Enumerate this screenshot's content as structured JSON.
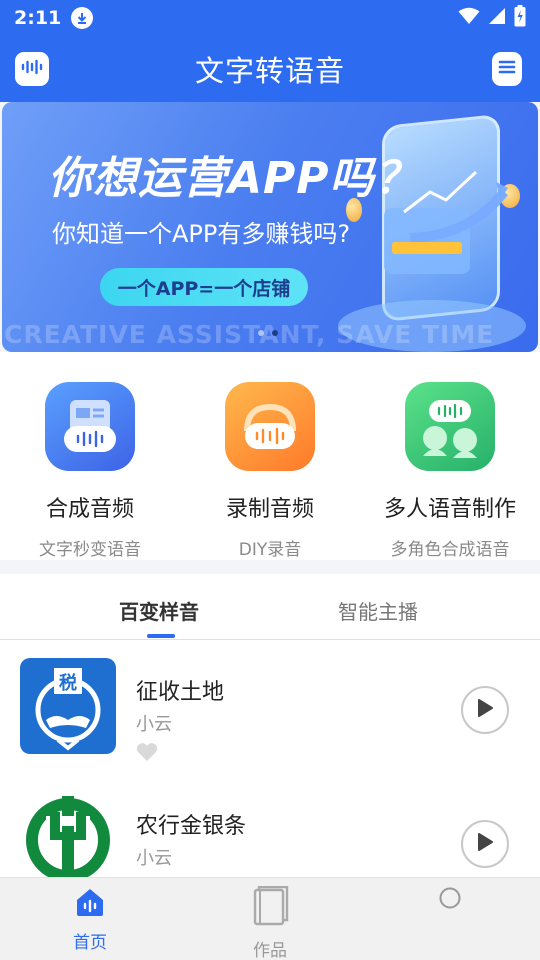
{
  "status_bar": {
    "time": "2:11"
  },
  "header": {
    "title": "文字转语音"
  },
  "banner": {
    "headline": "你想运营APP吗？",
    "subline": "你知道一个APP有多赚钱吗?",
    "pill_label": "一个APP=一个店铺",
    "watermark": "CREATIVE ASSISTANT, SAVE TIME"
  },
  "quick_actions": [
    {
      "title": "合成音频",
      "subtitle": "文字秒变语音"
    },
    {
      "title": "录制音频",
      "subtitle": "DIY录音"
    },
    {
      "title": "多人语音制作",
      "subtitle": "多角色合成语音"
    }
  ],
  "tabs": [
    {
      "label": "百变样音"
    },
    {
      "label": "智能主播"
    }
  ],
  "list": [
    {
      "title": "征收土地",
      "author": "小云"
    },
    {
      "title": "农行金银条",
      "author": "小云"
    }
  ],
  "bottom_nav": [
    {
      "label": "首页"
    },
    {
      "label": "作品"
    },
    {
      "label": ""
    }
  ],
  "colors": {
    "brand": "#2d6bf0",
    "text": "#222222",
    "muted": "#999999"
  }
}
